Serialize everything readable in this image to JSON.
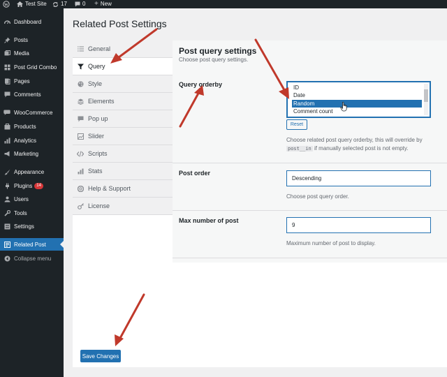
{
  "admin_bar": {
    "site_name": "Test Site",
    "updates_count": "17",
    "comments_count": "0",
    "new_label": "New"
  },
  "admin_menu": [
    {
      "label": "Dashboard",
      "icon": "dashboard-icon"
    },
    {
      "label": "Posts",
      "icon": "pin-icon"
    },
    {
      "label": "Media",
      "icon": "media-icon"
    },
    {
      "label": "Post Grid Combo",
      "icon": "grid-icon"
    },
    {
      "label": "Pages",
      "icon": "pages-icon"
    },
    {
      "label": "Comments",
      "icon": "comments-icon"
    },
    {
      "label": "WooCommerce",
      "icon": "woocommerce-icon"
    },
    {
      "label": "Products",
      "icon": "products-icon"
    },
    {
      "label": "Analytics",
      "icon": "analytics-icon"
    },
    {
      "label": "Marketing",
      "icon": "megaphone-icon"
    },
    {
      "label": "Appearance",
      "icon": "brush-icon"
    },
    {
      "label": "Plugins",
      "icon": "plugins-icon",
      "badge": "14"
    },
    {
      "label": "Users",
      "icon": "users-icon"
    },
    {
      "label": "Tools",
      "icon": "tools-icon"
    },
    {
      "label": "Settings",
      "icon": "settings-icon"
    },
    {
      "label": "Related Post",
      "icon": "related-post-icon"
    },
    {
      "label": "Collapse menu",
      "icon": "collapse-icon"
    }
  ],
  "page": {
    "title": "Related Post Settings",
    "save_button": "Save Changes"
  },
  "tabs": [
    {
      "label": "General",
      "icon": "list-icon"
    },
    {
      "label": "Query",
      "icon": "filter-icon"
    },
    {
      "label": "Style",
      "icon": "palette-icon"
    },
    {
      "label": "Elements",
      "icon": "layers-icon"
    },
    {
      "label": "Pop up",
      "icon": "chat-icon"
    },
    {
      "label": "Slider",
      "icon": "slider-icon"
    },
    {
      "label": "Scripts",
      "icon": "code-icon"
    },
    {
      "label": "Stats",
      "icon": "chart-icon"
    },
    {
      "label": "Help & Support",
      "icon": "help-icon"
    },
    {
      "label": "License",
      "icon": "key-icon"
    }
  ],
  "active_tab": "Query",
  "section": {
    "title": "Post query settings",
    "description": "Choose post query settings."
  },
  "query_orderby": {
    "label": "Query orderby",
    "options": [
      "ID",
      "Date",
      "Random",
      "Comment count"
    ],
    "selected": "Random",
    "reset_label": "Reset",
    "description_before": "Choose related post query orderby, this will override by",
    "description_code": "post__in",
    "description_after": "if manually selected post is not empty."
  },
  "post_order": {
    "label": "Post order",
    "value": "Descending",
    "description": "Choose post query order."
  },
  "max_posts": {
    "label": "Max number of post",
    "value": "9",
    "description": "Maximum number of post to display."
  },
  "colors": {
    "accent": "#2271b1",
    "admin_bg": "#1d2327",
    "annotation_arrow": "#c0392b"
  }
}
